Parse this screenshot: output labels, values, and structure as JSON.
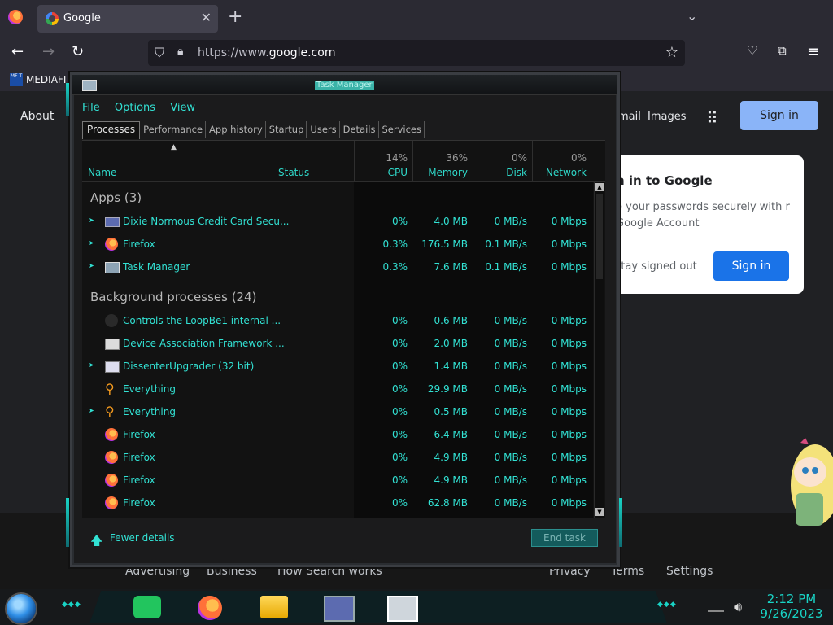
{
  "browser": {
    "tab_title": "Google",
    "url_prefix": "https://www.",
    "url_domain": "google.com",
    "bookmark_label": "MEDIAFI",
    "bookmark_icon_text": "MF T"
  },
  "google": {
    "about": "About",
    "gmail": "mail",
    "images": "Images",
    "sign_in": "Sign in",
    "promo_title": "n in to Google",
    "promo_body": "e your passwords securely with r Google Account",
    "promo_stay": "Stay signed out",
    "promo_signin": "Sign in",
    "footer_left": [
      "Advertising",
      "Business",
      "How Search works"
    ],
    "footer_right": [
      "Privacy",
      "Terms",
      "Settings"
    ]
  },
  "task_manager": {
    "title": "Task Manager",
    "menu": [
      "File",
      "Options",
      "View"
    ],
    "tabs": [
      "Processes",
      "Performance",
      "App history",
      "Startup",
      "Users",
      "Details",
      "Services"
    ],
    "columns": {
      "name": "Name",
      "status": "Status",
      "cpu_pct": "14%",
      "cpu": "CPU",
      "mem_pct": "36%",
      "memory": "Memory",
      "disk_pct": "0%",
      "disk": "Disk",
      "net_pct": "0%",
      "network": "Network"
    },
    "apps_header": "Apps (3)",
    "bg_header": "Background processes (24)",
    "apps": [
      {
        "name": "Dixie Normous Credit Card Secu...",
        "cpu": "0%",
        "mem": "4.0 MB",
        "disk": "0 MB/s",
        "net": "0 Mbps",
        "icon": "card-icon",
        "expand": true
      },
      {
        "name": "Firefox",
        "cpu": "0.3%",
        "mem": "176.5 MB",
        "disk": "0.1 MB/s",
        "net": "0 Mbps",
        "icon": "firefox-icon",
        "expand": true
      },
      {
        "name": "Task Manager",
        "cpu": "0.3%",
        "mem": "7.6 MB",
        "disk": "0.1 MB/s",
        "net": "0 Mbps",
        "icon": "task-manager-icon",
        "expand": true
      }
    ],
    "background": [
      {
        "name": "Controls the LoopBe1 internal ...",
        "cpu": "0%",
        "mem": "0.6 MB",
        "disk": "0 MB/s",
        "net": "0 Mbps",
        "icon": "loopbe-icon",
        "expand": false
      },
      {
        "name": "Device Association Framework ...",
        "cpu": "0%",
        "mem": "2.0 MB",
        "disk": "0 MB/s",
        "net": "0 Mbps",
        "icon": "device-icon",
        "expand": false
      },
      {
        "name": "DissenterUpgrader (32 bit)",
        "cpu": "0%",
        "mem": "1.4 MB",
        "disk": "0 MB/s",
        "net": "0 Mbps",
        "icon": "dissenter-icon",
        "expand": true
      },
      {
        "name": "Everything",
        "cpu": "0%",
        "mem": "29.9 MB",
        "disk": "0 MB/s",
        "net": "0 Mbps",
        "icon": "everything-icon",
        "expand": false
      },
      {
        "name": "Everything",
        "cpu": "0%",
        "mem": "0.5 MB",
        "disk": "0 MB/s",
        "net": "0 Mbps",
        "icon": "everything-icon",
        "expand": true
      },
      {
        "name": "Firefox",
        "cpu": "0%",
        "mem": "6.4 MB",
        "disk": "0 MB/s",
        "net": "0 Mbps",
        "icon": "firefox-icon",
        "expand": false
      },
      {
        "name": "Firefox",
        "cpu": "0%",
        "mem": "4.9 MB",
        "disk": "0 MB/s",
        "net": "0 Mbps",
        "icon": "firefox-icon",
        "expand": false
      },
      {
        "name": "Firefox",
        "cpu": "0%",
        "mem": "4.9 MB",
        "disk": "0 MB/s",
        "net": "0 Mbps",
        "icon": "firefox-icon",
        "expand": false
      },
      {
        "name": "Firefox",
        "cpu": "0%",
        "mem": "62.8 MB",
        "disk": "0 MB/s",
        "net": "0 Mbps",
        "icon": "firefox-icon",
        "expand": false
      }
    ],
    "fewer_details": "Fewer details",
    "end_task": "End task"
  },
  "taskbar": {
    "time": "2:12 PM",
    "date": "9/26/2023"
  },
  "colors": {
    "accent": "#32e1d3",
    "google_signin": "#8ab4f8",
    "promo_button": "#1a73e8"
  }
}
